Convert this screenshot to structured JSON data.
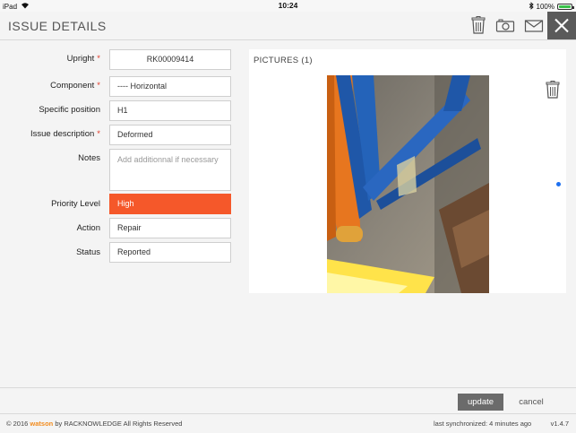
{
  "status_bar": {
    "device": "iPad",
    "time": "10:24",
    "battery": "100%"
  },
  "header": {
    "title": "ISSUE DETAILS"
  },
  "form": {
    "upright": {
      "label": "Upright",
      "value": "RK00009414"
    },
    "component": {
      "label": "Component",
      "value": "---- Horizontal"
    },
    "specific_position": {
      "label": "Specific position",
      "value": "H1"
    },
    "issue_description": {
      "label": "Issue description",
      "value": "Deformed"
    },
    "notes": {
      "label": "Notes",
      "placeholder": "Add additionnal if necessary"
    },
    "priority_level": {
      "label": "Priority Level",
      "value": "High",
      "color": "#f5582a"
    },
    "action": {
      "label": "Action",
      "value": "Repair"
    },
    "status": {
      "label": "Status",
      "value": "Reported"
    },
    "required_marker": "*"
  },
  "pictures": {
    "title": "PICTURES (1)"
  },
  "actions": {
    "update_label": "update",
    "cancel_label": "cancel"
  },
  "footer": {
    "copyright_prefix": "© 2016",
    "brand": "watson",
    "copyright_suffix": "by RACKNOWLEDGE All Rights Reserved",
    "sync": "last synchronized: 4 minutes ago",
    "version": "v1.4.7"
  },
  "icons": [
    "wifi-icon",
    "bluetooth-icon",
    "battery-icon",
    "trash-icon",
    "camera-icon",
    "mail-icon",
    "close-icon"
  ],
  "colors": {
    "accent": "#f5582a",
    "brand": "#f28c1e",
    "close_bg": "#5a5a5a",
    "page_dot": "#1d6ff0"
  }
}
